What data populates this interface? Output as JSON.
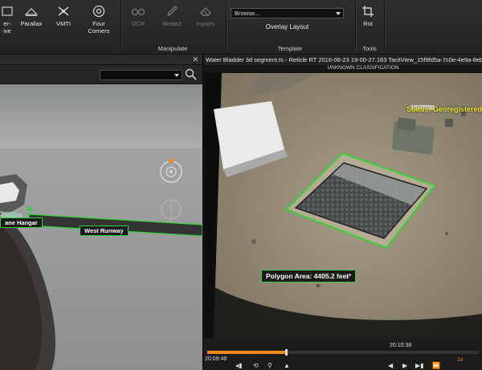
{
  "ribbon": {
    "buttons": [
      {
        "label": "er-\nive",
        "icon": "frame-icon",
        "enabled": true
      },
      {
        "label": "Parallax",
        "icon": "parallax-icon",
        "enabled": true
      },
      {
        "label": "VMTI",
        "icon": "satellite-icon",
        "enabled": true
      },
      {
        "label": "Four\nCorners",
        "icon": "target-icon",
        "enabled": true
      },
      {
        "label": "OCR",
        "icon": "glasses-icon",
        "enabled": false
      },
      {
        "label": "Redact",
        "icon": "pencil-icon",
        "enabled": false
      },
      {
        "label": "Inpaint",
        "icon": "eraser-icon",
        "enabled": false
      },
      {
        "label": "RoI",
        "icon": "crop-icon",
        "enabled": true
      }
    ],
    "groups": {
      "manipulate": "Manipulate",
      "template": "Template",
      "tools": "Tools"
    },
    "browse": {
      "value": "Browse..."
    },
    "overlay_layout": "Overlay Layout"
  },
  "map": {
    "labels": {
      "hangar": "ane Hangar",
      "runway": "West Runway"
    }
  },
  "video": {
    "title": "Water Bladder 3d segment.ts - Reticle RT 2016-06-23 19-00-27.163 TacitView_15f9fd5a-7c0e-4e9a-8eb",
    "classification": "UNKNOWN CLASSIFICATION",
    "status": "Status: Georegistered",
    "polygon_label": "Polygon Area: 4405.2 feet²",
    "time_current": "20:09:48",
    "time_end": "20:10:38",
    "progress": 0.29,
    "speed": "1x"
  },
  "colors": {
    "accent_orange": "#f08a1a",
    "overlay_green": "#35d135",
    "status_yellow": "#f3ea2a"
  }
}
